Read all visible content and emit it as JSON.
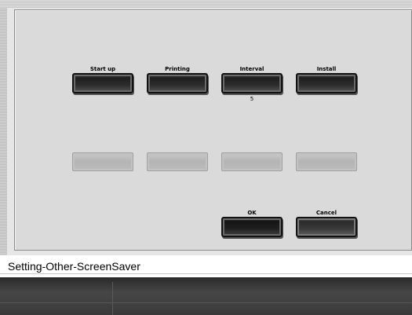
{
  "buttons_row1": [
    {
      "label": "Start up",
      "value": ""
    },
    {
      "label": "Printing",
      "value": ""
    },
    {
      "label": "Interval",
      "value": "5"
    },
    {
      "label": "Install",
      "value": ""
    }
  ],
  "buttons_row3": [
    {
      "label": "OK"
    },
    {
      "label": "Cancel"
    }
  ],
  "status": {
    "breadcrumb": "Setting-Other-ScreenSaver"
  }
}
